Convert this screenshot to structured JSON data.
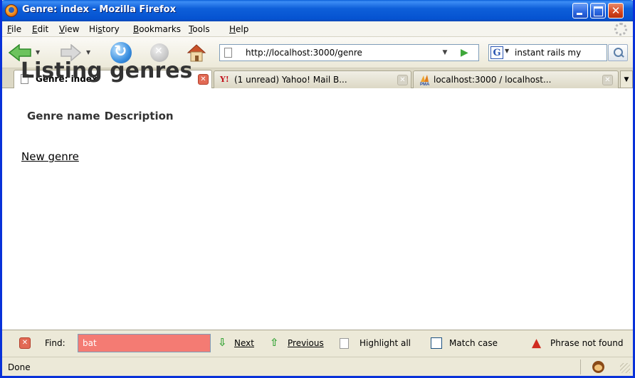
{
  "window": {
    "title": "Genre: index - Mozilla Firefox"
  },
  "menu": [
    {
      "key": "F",
      "rest": "ile"
    },
    {
      "key": "E",
      "rest": "dit"
    },
    {
      "key": "V",
      "rest": "iew"
    },
    {
      "pre": "Hi",
      "key": "s",
      "rest": "tory"
    },
    {
      "key": "B",
      "rest": "ookmarks"
    },
    {
      "key": "T",
      "rest": "ools"
    },
    {
      "key": "H",
      "rest": "elp"
    }
  ],
  "navbar": {
    "url": "http://localhost:3000/genre",
    "search_engine": "G",
    "search_text": "instant rails my"
  },
  "tabs": [
    {
      "label": "Genre: index",
      "active": true
    },
    {
      "label": "(1 unread) Yahoo! Mail B...",
      "favicon": "Y!"
    },
    {
      "label": "localhost:3000 / localhost...",
      "favicon": "PMA"
    }
  ],
  "page": {
    "title": "Listing genres",
    "columns": [
      "Genre name",
      "Description"
    ],
    "new_link": "New genre"
  },
  "findbar": {
    "label": "Find:",
    "value": "bat",
    "next": "Next",
    "previous": "Previous",
    "highlight": "Highlight all",
    "match_case": "Match case",
    "message": "Phrase not found"
  },
  "status": {
    "text": "Done"
  },
  "icons": {
    "back": "back-arrow-icon",
    "forward": "forward-arrow-icon",
    "reload": "reload-icon",
    "stop": "stop-icon",
    "home": "home-icon",
    "search": "magnifier-icon"
  },
  "colors": {
    "titlebar": "#0553d1",
    "find_not_found": "#f47b73",
    "accent_green": "#3aa63a"
  }
}
